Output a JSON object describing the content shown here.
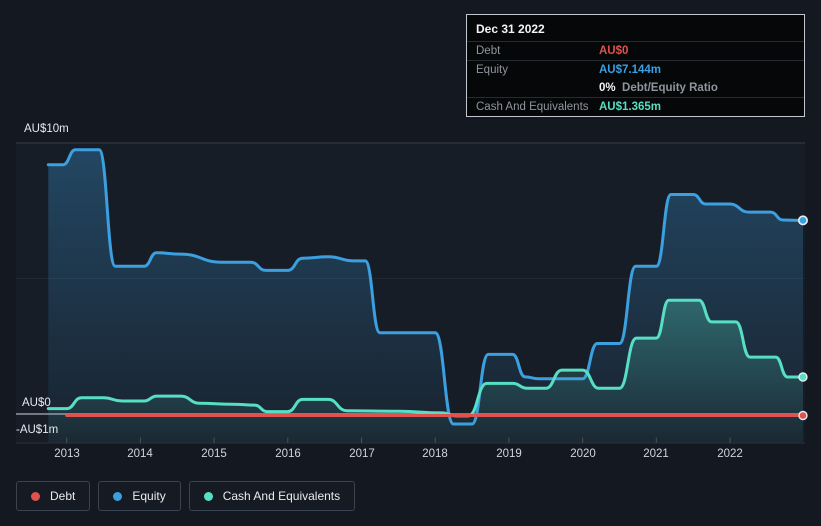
{
  "tooltip": {
    "date": "Dec 31 2022",
    "debt_label": "Debt",
    "debt_value": "AU$0",
    "equity_label": "Equity",
    "equity_value": "AU$7.144m",
    "ratio_value": "0%",
    "ratio_label": "Debt/Equity Ratio",
    "cash_label": "Cash And Equivalents",
    "cash_value": "AU$1.365m"
  },
  "axis": {
    "y_top_label": "AU$10m",
    "y_zero_label": "AU$0",
    "y_bottom_label": "-AU$1m",
    "years": [
      2013,
      2014,
      2015,
      2016,
      2017,
      2018,
      2019,
      2020,
      2021,
      2022
    ]
  },
  "colors": {
    "debt": "#e0524e",
    "equity": "#3b9fe0",
    "cash": "#57dfc4",
    "grid_top": "#394049",
    "grid_zero": "#aab0b9",
    "axis_line": "#2b3039",
    "tick": "#4a515b"
  },
  "chart_data": {
    "type": "area",
    "title": "Debt / Equity / Cash history",
    "x_unit": "year",
    "x_range": [
      2012.75,
      2022.99
    ],
    "ylim_m": [
      -1.1,
      10
    ],
    "y_gridlines_m": [
      10,
      5,
      0
    ],
    "legend_position": "bottom-left",
    "series": [
      {
        "name": "Debt",
        "color": "#e0524e",
        "unit": "AU$m",
        "points": [
          [
            2013.0,
            0
          ],
          [
            2022.99,
            0
          ]
        ]
      },
      {
        "name": "Equity",
        "color": "#3b9fe0",
        "unit": "AU$m",
        "points": [
          [
            2012.75,
            9.2
          ],
          [
            2012.95,
            9.2
          ],
          [
            2013.12,
            9.75
          ],
          [
            2013.44,
            9.75
          ],
          [
            2013.66,
            5.45
          ],
          [
            2014.05,
            5.45
          ],
          [
            2014.22,
            5.95
          ],
          [
            2014.55,
            5.9
          ],
          [
            2015.1,
            5.6
          ],
          [
            2015.5,
            5.6
          ],
          [
            2015.7,
            5.3
          ],
          [
            2016.0,
            5.3
          ],
          [
            2016.2,
            5.75
          ],
          [
            2016.55,
            5.8
          ],
          [
            2016.9,
            5.65
          ],
          [
            2017.05,
            5.65
          ],
          [
            2017.25,
            3.0
          ],
          [
            2018.0,
            3.0
          ],
          [
            2018.25,
            -0.37
          ],
          [
            2018.5,
            -0.37
          ],
          [
            2018.72,
            2.2
          ],
          [
            2019.05,
            2.2
          ],
          [
            2019.22,
            1.37
          ],
          [
            2019.4,
            1.3
          ],
          [
            2020.0,
            1.3
          ],
          [
            2020.2,
            2.6
          ],
          [
            2020.5,
            2.6
          ],
          [
            2020.72,
            5.45
          ],
          [
            2021.0,
            5.45
          ],
          [
            2021.2,
            8.1
          ],
          [
            2021.5,
            8.1
          ],
          [
            2021.67,
            7.75
          ],
          [
            2022.0,
            7.75
          ],
          [
            2022.25,
            7.45
          ],
          [
            2022.55,
            7.45
          ],
          [
            2022.72,
            7.16
          ],
          [
            2022.99,
            7.144
          ]
        ]
      },
      {
        "name": "Cash And Equivalents",
        "color": "#57dfc4",
        "unit": "AU$m",
        "points": [
          [
            2012.75,
            0.2
          ],
          [
            2013.0,
            0.2
          ],
          [
            2013.2,
            0.6
          ],
          [
            2013.5,
            0.6
          ],
          [
            2013.75,
            0.48
          ],
          [
            2014.05,
            0.48
          ],
          [
            2014.22,
            0.66
          ],
          [
            2014.55,
            0.66
          ],
          [
            2014.8,
            0.4
          ],
          [
            2015.25,
            0.36
          ],
          [
            2015.55,
            0.33
          ],
          [
            2015.72,
            0.09
          ],
          [
            2016.0,
            0.09
          ],
          [
            2016.2,
            0.54
          ],
          [
            2016.55,
            0.54
          ],
          [
            2016.8,
            0.12
          ],
          [
            2017.5,
            0.1
          ],
          [
            2018.1,
            0.04
          ],
          [
            2018.28,
            -0.07
          ],
          [
            2018.45,
            -0.07
          ],
          [
            2018.7,
            1.13
          ],
          [
            2019.05,
            1.13
          ],
          [
            2019.25,
            0.95
          ],
          [
            2019.5,
            0.95
          ],
          [
            2019.72,
            1.62
          ],
          [
            2020.0,
            1.62
          ],
          [
            2020.22,
            0.95
          ],
          [
            2020.5,
            0.95
          ],
          [
            2020.73,
            2.8
          ],
          [
            2021.0,
            2.8
          ],
          [
            2021.17,
            4.2
          ],
          [
            2021.58,
            4.2
          ],
          [
            2021.75,
            3.4
          ],
          [
            2022.08,
            3.4
          ],
          [
            2022.27,
            2.1
          ],
          [
            2022.62,
            2.1
          ],
          [
            2022.78,
            1.365
          ],
          [
            2022.99,
            1.365
          ]
        ]
      }
    ]
  }
}
